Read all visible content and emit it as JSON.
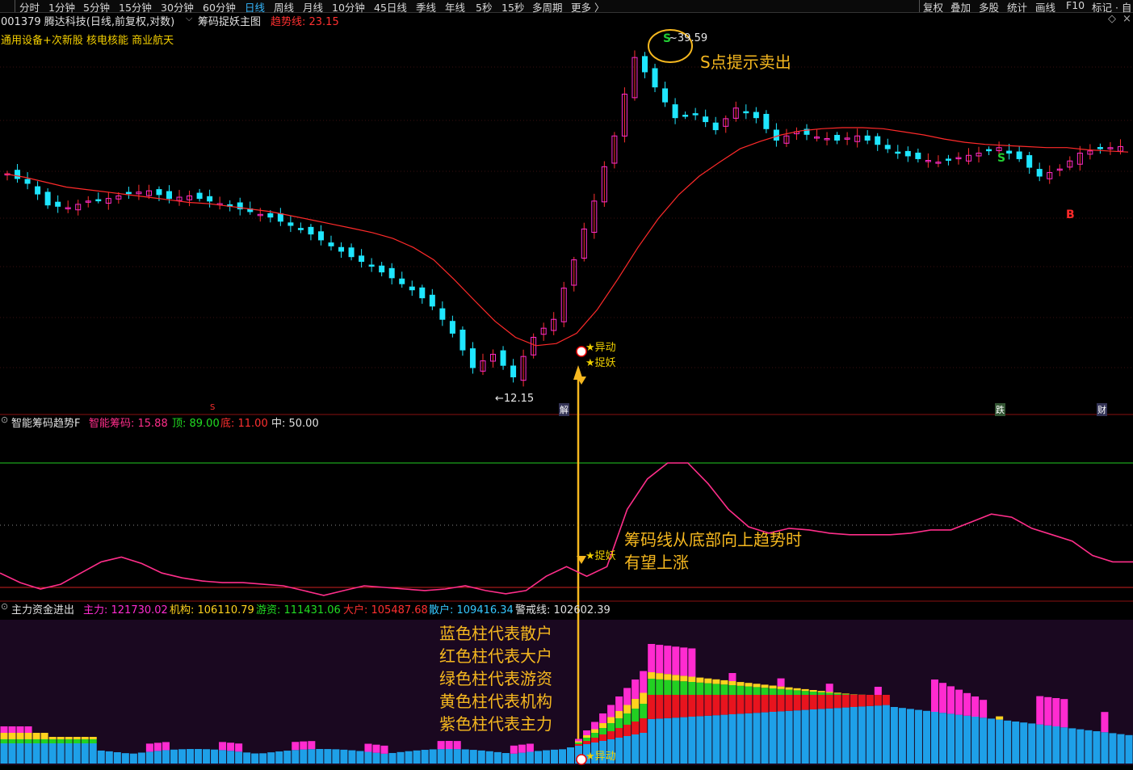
{
  "toolbar": {
    "periods": [
      "分时",
      "1分钟",
      "5分钟",
      "15分钟",
      "30分钟",
      "60分钟",
      "日线",
      "周线",
      "月线",
      "10分钟",
      "45日线",
      "季线",
      "年线",
      "5秒",
      "15秒",
      "多周期",
      "更多 〉"
    ],
    "active_period": "日线",
    "right_buttons": [
      "复权",
      "叠加",
      "多股",
      "统计",
      "画线",
      "F10",
      "标记 · 自"
    ]
  },
  "stock": {
    "title": "001379 腾达科技(日线,前复权,对数)",
    "indicator_name": "筹码捉妖主图",
    "trend_label": "趋势线: 23.15",
    "concepts": "通用设备+次新股 核电核能 商业航天"
  },
  "main_chart": {
    "high_label": "39.59",
    "low_label": "12.15",
    "signals": {
      "yidong": "★异动",
      "zhuoyao": "★捉妖",
      "s_mark": "S",
      "b_mark": "B"
    },
    "markers": {
      "jie": "解",
      "die": "跌",
      "cai": "财",
      "s_small": "S"
    }
  },
  "mid_panel": {
    "name": "智能筹码趋势F",
    "chip_label": "智能筹码: 15.88",
    "top_label": "顶: 89.00",
    "bottom_label": "底: 11.00",
    "mid_label": "中: 50.00",
    "signal": "★捉妖"
  },
  "bottom_panel": {
    "name": "主力资金进出",
    "zhuli": "主力: 121730.02",
    "jigou": "机构: 106110.79",
    "youzi": "游资: 111431.06",
    "dahu": "大户: 105487.68",
    "sanhu": "散户: 109416.34",
    "jingjie": "警戒线: 102602.39",
    "signal": "★异动"
  },
  "annotations": {
    "sell_hint": "S点提示卖出",
    "chip_line_1": "筹码线从底部向上趋势时",
    "chip_line_2": "有望上涨",
    "legend_lines": [
      "蓝色柱代表散户",
      "红色柱代表大户",
      "绿色柱代表游资",
      "黄色柱代表机构",
      "紫色柱代表主力"
    ]
  },
  "colors": {
    "up": "#ff2bd0",
    "down": "#1fe6ff",
    "ma": "#ff2a2a",
    "chip": "#ff2e8a",
    "blue": "#1ea0e8",
    "red": "#e8141e",
    "green": "#22d022",
    "yellow": "#ffd21e",
    "purple": "#ff2bd0",
    "annotation": "#f6b81f"
  },
  "chart_data": {
    "type": "candlestick",
    "ylim": [
      11.5,
      40.5
    ],
    "ma": [
      25.0,
      24.7,
      24.3,
      23.9,
      23.7,
      23.5,
      23.3,
      23.1,
      22.9,
      22.7,
      22.6,
      22.4,
      22.2,
      22.0,
      21.7,
      21.4,
      21.1,
      20.8,
      20.5,
      20.1,
      19.5,
      18.7,
      17.5,
      16.3,
      15.2,
      14.4,
      14.0,
      14.1,
      14.6,
      15.8,
      17.5,
      19.5,
      21.5,
      23.3,
      24.8,
      26.0,
      27.2,
      27.9,
      28.5,
      28.9,
      29.1,
      29.2,
      29.2,
      29.1,
      28.8,
      28.5,
      28.1,
      27.8,
      27.6,
      27.5,
      27.4,
      27.3,
      27.3,
      27.1,
      27.0,
      26.9
    ],
    "chip_trend": [
      20,
      14,
      10,
      13,
      20,
      27,
      30,
      26,
      20,
      17,
      15,
      14,
      14,
      13,
      12,
      9,
      6,
      9,
      12,
      11,
      10,
      9,
      10,
      12,
      9,
      7,
      9,
      18,
      24,
      18,
      24,
      60,
      79,
      89,
      89,
      76,
      60,
      49,
      45,
      48,
      47,
      45,
      44,
      44,
      44,
      45,
      47,
      47,
      52,
      57,
      55,
      48,
      44,
      40,
      31,
      27,
      27
    ]
  }
}
